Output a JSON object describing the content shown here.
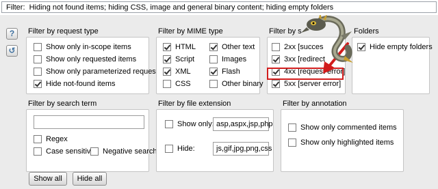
{
  "filter_bar": {
    "label": "Filter:",
    "summary": "Hiding not found items;  hiding CSS, image and general binary content;  hiding empty folders"
  },
  "side_buttons": [
    {
      "icon": "help-icon",
      "glyph": "?"
    },
    {
      "icon": "restore-defaults-icon",
      "glyph": "↺"
    }
  ],
  "request_type": {
    "title": "Filter by request type",
    "options": [
      {
        "label": "Show only in-scope items",
        "checked": false
      },
      {
        "label": "Show only requested items",
        "checked": false
      },
      {
        "label": "Show only parameterized requests",
        "checked": false
      },
      {
        "label": "Hide not-found items",
        "checked": true
      }
    ]
  },
  "mime_type": {
    "title": "Filter by MIME type",
    "left": [
      {
        "label": "HTML",
        "checked": true
      },
      {
        "label": "Script",
        "checked": true
      },
      {
        "label": "XML",
        "checked": true
      },
      {
        "label": "CSS",
        "checked": false
      }
    ],
    "right": [
      {
        "label": "Other text",
        "checked": true
      },
      {
        "label": "Images",
        "checked": false
      },
      {
        "label": "Flash",
        "checked": true
      },
      {
        "label": "Other binary",
        "checked": false
      }
    ]
  },
  "status_code": {
    "title": "Filter by s",
    "options": [
      {
        "label": "2xx  [succes",
        "checked": false
      },
      {
        "label": "3xx  [redirect",
        "checked": true
      },
      {
        "label": "4xx  [request error]",
        "checked": true
      },
      {
        "label": "5xx  [server error]",
        "checked": true
      }
    ]
  },
  "folders": {
    "title": "Folders",
    "options": [
      {
        "label": "Hide empty folders",
        "checked": true
      }
    ]
  },
  "search_term": {
    "title": "Filter by search term",
    "value": "",
    "options": [
      {
        "label": "Regex",
        "checked": false
      },
      {
        "label": "Case sensitive",
        "checked": false
      },
      {
        "label": "Negative search",
        "checked": false
      }
    ]
  },
  "file_extension": {
    "title": "Filter by file extension",
    "show_only": {
      "label": "Show only:",
      "checked": false,
      "value": "asp,aspx,jsp,php"
    },
    "hide": {
      "label": "Hide:",
      "checked": false,
      "value": "js,gif,jpg,png,css"
    }
  },
  "annotation": {
    "title": "Filter by annotation",
    "options": [
      {
        "label": "Show only commented items",
        "checked": false
      },
      {
        "label": "Show only highlighted items",
        "checked": false
      }
    ]
  },
  "buttons": {
    "show_all": "Show all",
    "hide_all": "Hide all"
  },
  "colors": {
    "panel_bg": "#ebebeb",
    "highlight": "#d11c1c",
    "arrow": "#d11c1c"
  }
}
